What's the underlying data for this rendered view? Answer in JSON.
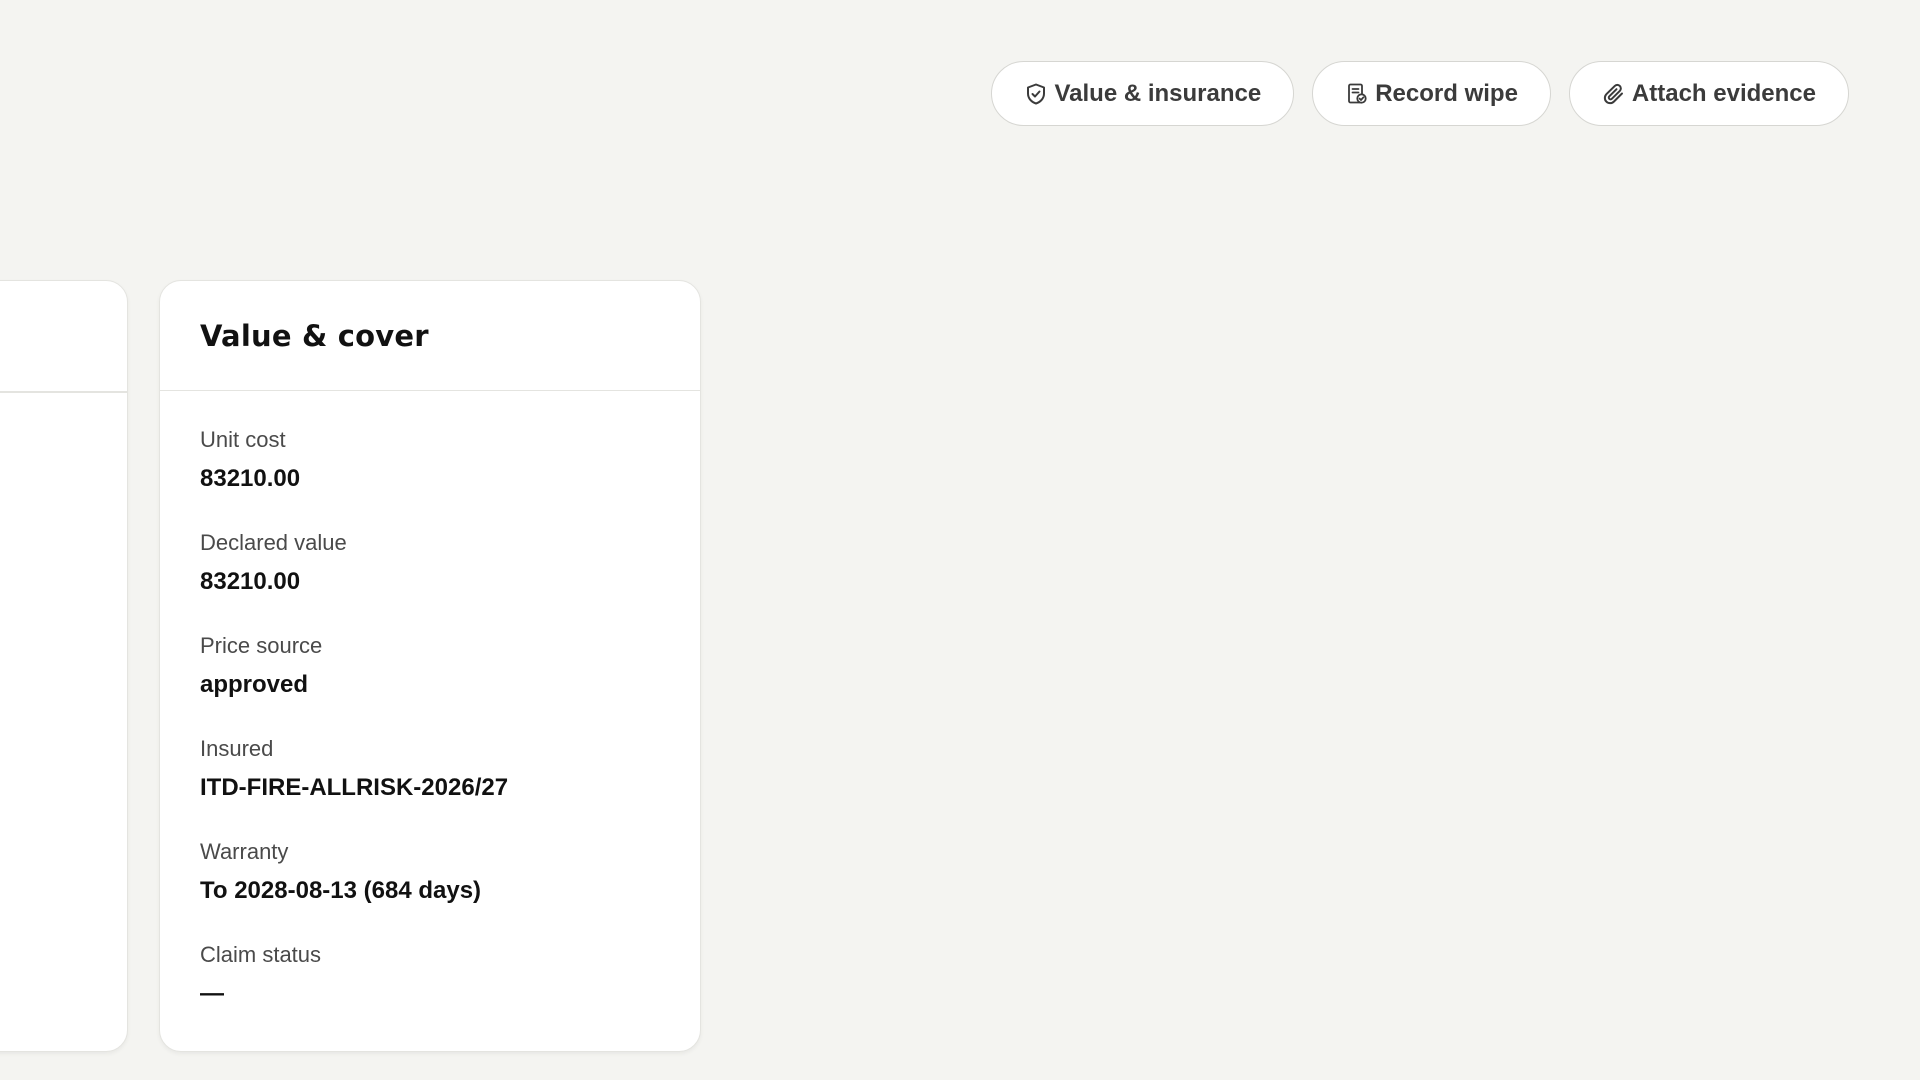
{
  "toolbar": {
    "buttons": [
      {
        "label": "Value & insurance",
        "icon": "shield-check-icon"
      },
      {
        "label": "Record wipe",
        "icon": "document-check-icon"
      },
      {
        "label": "Attach evidence",
        "icon": "paperclip-icon"
      }
    ]
  },
  "value_cover": {
    "title": "Value & cover",
    "fields": [
      {
        "label": "Unit cost",
        "value": "83210.00"
      },
      {
        "label": "Declared value",
        "value": "83210.00"
      },
      {
        "label": "Price source",
        "value": "approved"
      },
      {
        "label": "Insured",
        "value": "ITD-FIRE-ALLRISK-2026/27"
      },
      {
        "label": "Warranty",
        "value": "To 2028-08-13 (684 days)"
      },
      {
        "label": "Claim status",
        "value": "—"
      }
    ]
  },
  "colors": {
    "background": "#f4f4f1",
    "card": "#ffffff",
    "border": "#e4e4e0",
    "button_text": "#3b3b3b"
  }
}
